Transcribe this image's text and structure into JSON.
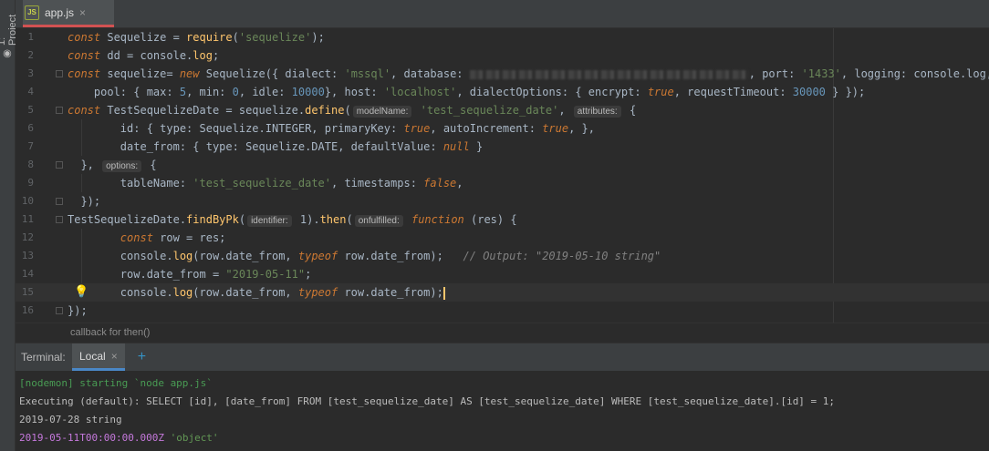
{
  "side_panel": {
    "label": "1: Project"
  },
  "editor_tab": {
    "filename": "app.js",
    "icon_text": "JS",
    "close": "×"
  },
  "code_lines": [
    {
      "n": "1"
    },
    {
      "n": "2"
    },
    {
      "n": "3"
    },
    {
      "n": "4"
    },
    {
      "n": "5"
    },
    {
      "n": "6"
    },
    {
      "n": "7"
    },
    {
      "n": "8"
    },
    {
      "n": "9"
    },
    {
      "n": "10"
    },
    {
      "n": "11"
    },
    {
      "n": "12"
    },
    {
      "n": "13"
    },
    {
      "n": "14"
    },
    {
      "n": "15"
    },
    {
      "n": "16"
    }
  ],
  "code": {
    "l1": [
      "const",
      " Sequelize = ",
      "require",
      "(",
      "'sequelize'",
      ");"
    ],
    "l2": [
      "const",
      " dd = console.",
      "log",
      ";"
    ],
    "l3": [
      "const",
      " sequelize= ",
      "new",
      " Sequelize({ dialect: ",
      "'mssql'",
      ", database: ",
      ", port: ",
      "'1433'",
      ", logging: console.log,"
    ],
    "l4": [
      "    pool: { max: ",
      "5",
      ", min: ",
      "0",
      ", idle: ",
      "10000",
      "}, host: ",
      "'localhost'",
      ", dialectOptions: { encrypt: ",
      "true",
      ", requestTimeout: ",
      "30000",
      " } });"
    ],
    "l5": [
      "const",
      " TestSequelizeDate = sequelize.",
      "define",
      "(",
      "modelName:",
      " ",
      "'test_sequelize_date'",
      ", ",
      "attributes:",
      " {"
    ],
    "l6": [
      "        id: { type: Sequelize.INTEGER, primaryKey: ",
      "true",
      ", autoIncrement: ",
      "true",
      ", },"
    ],
    "l7": [
      "        date_from: { type: Sequelize.DATE, defaultValue: ",
      "null",
      " }"
    ],
    "l8": [
      "  }, ",
      "options:",
      " {"
    ],
    "l9": [
      "        tableName: ",
      "'test_sequelize_date'",
      ", timestamps: ",
      "false",
      ","
    ],
    "l10": [
      "  });"
    ],
    "l11": [
      "TestSequelizeDate.",
      "findByPk",
      "(",
      "identifier:",
      " 1).",
      "then",
      "(",
      "onfulfilled:",
      " ",
      "function",
      " (res) {"
    ],
    "l12": [
      "        ",
      "const",
      " row = res;"
    ],
    "l13": [
      "        console.",
      "log",
      "(row.date_from, ",
      "typeof",
      " row.date_from);   ",
      "// Output: \"2019-05-10 string\""
    ],
    "l14": [
      "        row.date_from = ",
      "\"2019-05-11\"",
      ";"
    ],
    "l15": [
      "        console.",
      "log",
      "(row.date_from, ",
      "typeof",
      " row.date_from);"
    ],
    "l16": [
      "});"
    ]
  },
  "breadcrumb": {
    "text": "callback for then()"
  },
  "terminal": {
    "title": "Terminal:",
    "tab_label": "Local",
    "tab_close": "×",
    "add": "+",
    "lines": {
      "l1": "[nodemon] starting `node app.js`",
      "l2": "Executing (default): SELECT [id], [date_from] FROM [test_sequelize_date] AS [test_sequelize_date] WHERE [test_sequelize_date].[id] = 1;",
      "l3": "2019-07-28 string",
      "l4a": "2019-05-11T00:00:00.000Z",
      "l4b": " 'object'"
    }
  },
  "colors": {
    "keyword": "#cc7832",
    "string": "#6a8759",
    "number": "#6897bb",
    "function": "#ffc66d",
    "tab_accent": "#d25252"
  }
}
